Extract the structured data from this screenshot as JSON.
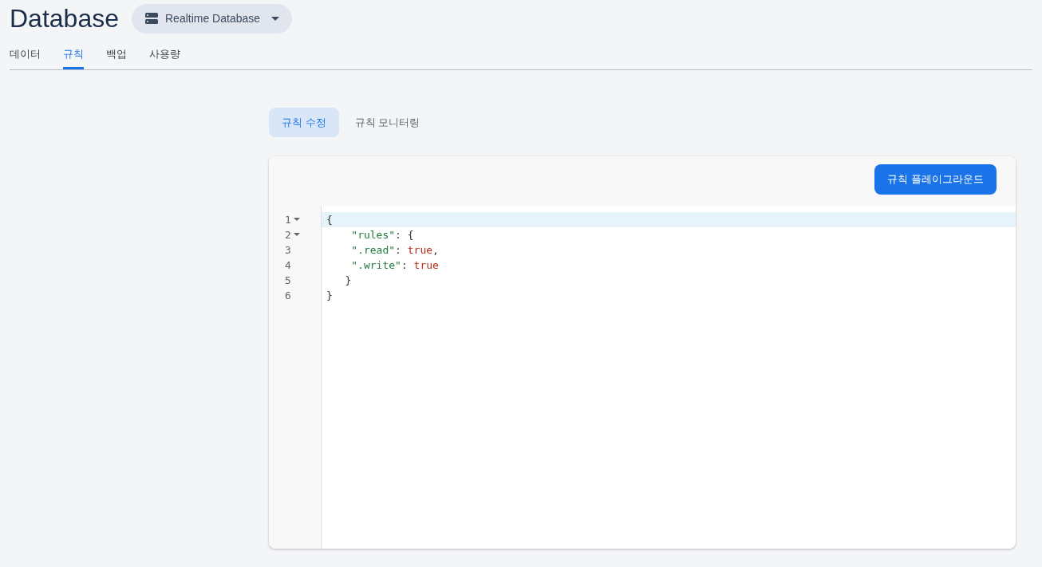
{
  "header": {
    "title": "Database",
    "db_selector": {
      "label": "Realtime Database"
    }
  },
  "tabs": [
    {
      "label": "데이터",
      "selected": false
    },
    {
      "label": "규칙",
      "selected": true
    },
    {
      "label": "백업",
      "selected": false
    },
    {
      "label": "사용량",
      "selected": false
    }
  ],
  "subtabs": [
    {
      "label": "규칙 수정",
      "selected": true
    },
    {
      "label": "규칙 모니터링",
      "selected": false
    }
  ],
  "editor": {
    "button": "규칙 플레이그라운드",
    "lines": [
      {
        "number": "1",
        "foldable": true,
        "active": true,
        "tokens": [
          {
            "kind": "punct",
            "text": "{"
          }
        ]
      },
      {
        "number": "2",
        "foldable": true,
        "active": false,
        "tokens": [
          {
            "kind": "string",
            "text": "    \"rules\""
          },
          {
            "kind": "punct",
            "text": ": {"
          }
        ]
      },
      {
        "number": "3",
        "foldable": false,
        "active": false,
        "tokens": [
          {
            "kind": "string",
            "text": "    \".read\""
          },
          {
            "kind": "punct",
            "text": ": "
          },
          {
            "kind": "keyword",
            "text": "true"
          },
          {
            "kind": "punct",
            "text": ","
          }
        ]
      },
      {
        "number": "4",
        "foldable": false,
        "active": false,
        "tokens": [
          {
            "kind": "string",
            "text": "    \".write\""
          },
          {
            "kind": "punct",
            "text": ": "
          },
          {
            "kind": "keyword",
            "text": "true"
          }
        ]
      },
      {
        "number": "5",
        "foldable": false,
        "active": false,
        "tokens": [
          {
            "kind": "punct",
            "text": "   }"
          }
        ]
      },
      {
        "number": "6",
        "foldable": false,
        "active": false,
        "tokens": [
          {
            "kind": "punct",
            "text": "}"
          }
        ]
      }
    ]
  }
}
